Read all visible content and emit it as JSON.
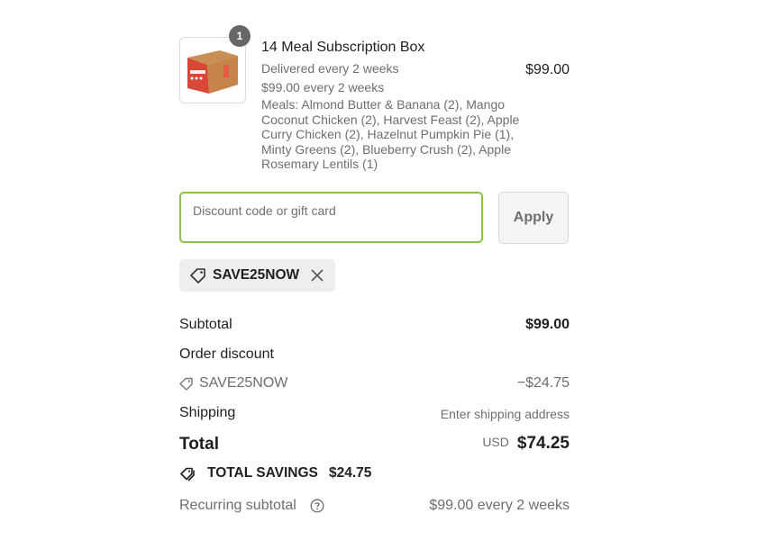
{
  "product": {
    "quantity": "1",
    "title": "14 Meal Subscription Box",
    "delivery": "Delivered every 2 weeks",
    "price_line": "$99.00 every 2 weeks",
    "meals": "Meals: Almond Butter & Banana (2), Mango Coconut Chicken (2), Harvest Feast (2), Apple Curry Chicken (2), Hazelnut Pumpkin Pie (1), Minty Greens (2), Blueberry Crush (2), Apple Rosemary Lentils (1)",
    "price": "$99.00",
    "image_icon": "red-subscription-box-image"
  },
  "discount": {
    "placeholder": "Discount code or gift card",
    "apply_label": "Apply",
    "applied_code": "SAVE25NOW",
    "input_border_color": "#8bc34a"
  },
  "summary": {
    "subtotal_label": "Subtotal",
    "subtotal_value": "$99.00",
    "order_discount_label": "Order discount",
    "discount_code": "SAVE25NOW",
    "discount_value": "−$24.75",
    "shipping_label": "Shipping",
    "shipping_value": "Enter shipping address",
    "total_label": "Total",
    "currency": "USD",
    "total_value": "$74.25",
    "savings_label": "TOTAL SAVINGS",
    "savings_value": "$24.75",
    "recurring_label": "Recurring subtotal",
    "recurring_value": "$99.00 every 2 weeks"
  }
}
